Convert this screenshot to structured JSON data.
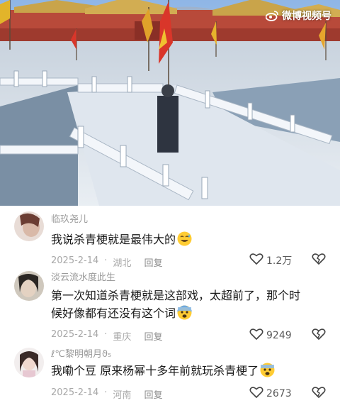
{
  "watermark": {
    "text": "微博视频号"
  },
  "comments": [
    {
      "username": "临玖尧儿",
      "text": "我说杀青梗就是最伟大的",
      "emoji": "sweat-smile-emoji",
      "date": "2025-2-14",
      "location": "湖北",
      "reply_label": "回复",
      "likes": "1.2万"
    },
    {
      "username": "淡云流水度此生",
      "text": "第一次知道杀青梗就是这部戏，太超前了，那个时候好像都有还没有这个词",
      "emoji": "fearful-emoji",
      "date": "2025-2-14",
      "location": "重庆",
      "reply_label": "回复",
      "likes": "9249"
    },
    {
      "username": "ℓ℃黎明朝月ϑ₅",
      "text": "我嘞个豆 原来杨幂十多年前就玩杀青梗了",
      "emoji": "fearful-emoji",
      "date": "2025-2-14",
      "location": "河南",
      "reply_label": "回复",
      "likes": "2673"
    }
  ]
}
